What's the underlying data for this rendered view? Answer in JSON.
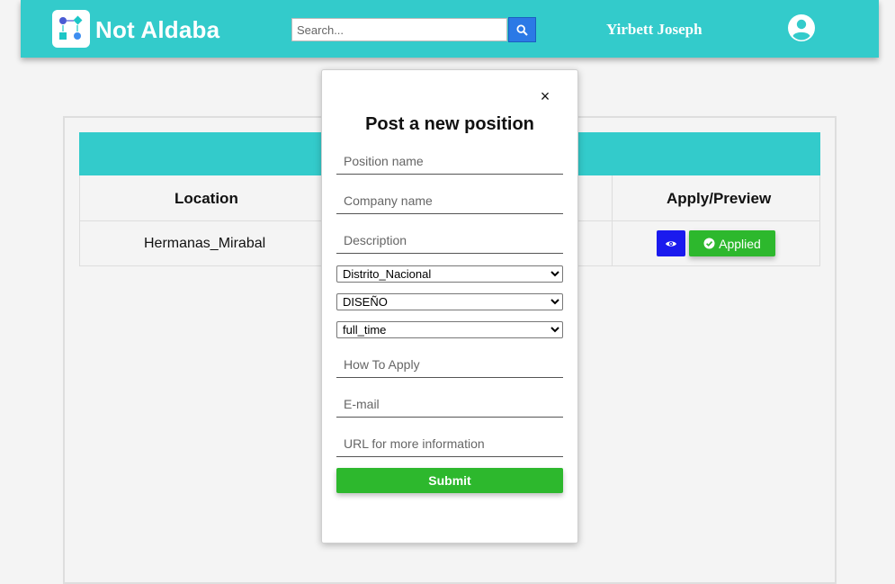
{
  "navbar": {
    "brand": "Not Aldaba",
    "search_placeholder": "Search...",
    "username": "Yirbett Joseph",
    "colors": {
      "bar": "#33cbcb",
      "search_button": "#2b79e6"
    }
  },
  "table": {
    "headers": {
      "location": "Location",
      "apply_preview": "Apply/Preview"
    },
    "rows": [
      {
        "location": "Hermanas_Mirabal",
        "applied_label": "Applied"
      }
    ]
  },
  "modal": {
    "title": "Post a new position",
    "close_label": "×",
    "fields": {
      "position_name": "Position name",
      "company_name": "Company name",
      "description": "Description",
      "how_to_apply": "How To Apply",
      "email": "E-mail",
      "url": "URL for more information"
    },
    "selects": {
      "location": "Distrito_Nacional",
      "category": "DISEÑO",
      "job_type": "full_time"
    },
    "submit_label": "Submit"
  }
}
